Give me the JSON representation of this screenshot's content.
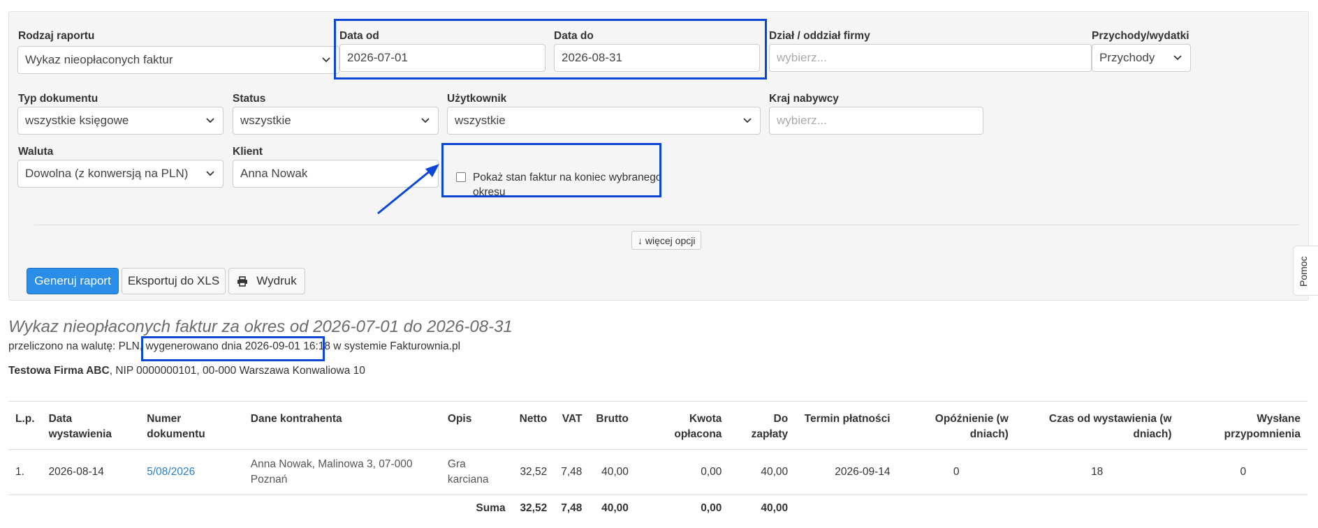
{
  "filters": {
    "report_type": {
      "label": "Rodzaj raportu",
      "value": "Wykaz nieopłaconych faktur"
    },
    "date_from": {
      "label": "Data od",
      "value": "2026-07-01"
    },
    "date_to": {
      "label": "Data do",
      "value": "2026-08-31"
    },
    "department": {
      "label": "Dział / oddział firmy",
      "placeholder": "wybierz..."
    },
    "income_expense": {
      "label": "Przychody/wydatki",
      "value": "Przychody"
    },
    "doc_type": {
      "label": "Typ dokumentu",
      "value": "wszystkie księgowe"
    },
    "status": {
      "label": "Status",
      "value": "wszystkie"
    },
    "user": {
      "label": "Użytkownik",
      "value": "wszystkie"
    },
    "buyer_country": {
      "label": "Kraj nabywcy",
      "placeholder": "wybierz..."
    },
    "currency": {
      "label": "Waluta",
      "value": "Dowolna (z konwersją na PLN)"
    },
    "client": {
      "label": "Klient",
      "value": "Anna Nowak"
    },
    "end_state_checkbox": {
      "label": "Pokaż stan faktur na koniec wybranego okresu",
      "checked": false
    }
  },
  "more_options": "↓ więcej opcji",
  "buttons": {
    "generate": "Generuj raport",
    "export": "Eksportuj do XLS",
    "print": "Wydruk"
  },
  "help_tab": "Pomoc",
  "report": {
    "title": "Wykaz nieopłaconych faktur za okres od 2026-07-01 do 2026-08-31",
    "sub_prefix": "przeliczono na walutę: PLN, ",
    "sub_generated": "wygenerowano dnia 2026-09-01 16:18",
    "sub_suffix": " w systemie Fakturownia.pl",
    "company_name": "Testowa Firma ABC",
    "company_rest": ", NIP 0000000101, 00-000 Warszawa Konwaliowa 10"
  },
  "table": {
    "headers": [
      "L.p.",
      "Data wystawienia",
      "Numer dokumentu",
      "Dane kontrahenta",
      "Opis",
      "Netto",
      "VAT",
      "Brutto",
      "Kwota opłacona",
      "Do zapłaty",
      "Termin płatności",
      "Opóźnienie (w dniach)",
      "Czas od wystawienia (w dniach)",
      "Wysłane przypomnienia"
    ],
    "rows": [
      {
        "lp": "1.",
        "date": "2026-08-14",
        "number": "5/08/2026",
        "contractor": "Anna Nowak, Malinowa 3, 07-000 Poznań",
        "desc": "Gra karciana",
        "net": "32,52",
        "vat": "7,48",
        "gross": "40,00",
        "paid": "0,00",
        "due": "40,00",
        "term": "2026-09-14",
        "delay": "0",
        "age": "18",
        "reminders": "0"
      }
    ],
    "sum": {
      "label": "Suma",
      "net": "32,52",
      "vat": "7,48",
      "gross": "40,00",
      "paid": "0,00",
      "due": "40,00"
    }
  },
  "colors": {
    "highlight": "#0a47d6",
    "primary": "#2a8ee8",
    "link": "#2a7ec2"
  }
}
